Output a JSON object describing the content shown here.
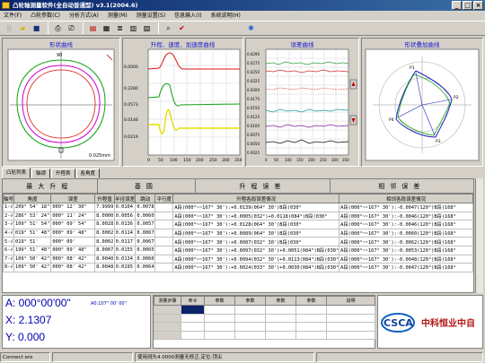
{
  "window": {
    "title": "凸轮轴测量软件(全自动普通型)  v3.1(2004.6)"
  },
  "menu": [
    "文件(F)",
    "凸轮参数(C)",
    "分析方式(A)",
    "测量(M)",
    "测量设置(S)",
    "信息输入(I)",
    "系统说明(H)"
  ],
  "toolbar_icons": [
    "new-icon",
    "open-icon",
    "save-icon",
    "print-icon",
    "print-preview-icon",
    "chart-icon",
    "table-icon",
    "list-icon",
    "grid-icon",
    "report-icon",
    "magnify-icon",
    "check-icon",
    "measure-icon"
  ],
  "panels": {
    "profile": {
      "title": "形状曲线",
      "top_label": "90",
      "scale_label": "0.025mm"
    },
    "kinematics": {
      "title": "升程、速度、加速度曲线",
      "y_ticks": [
        "6.0000",
        "0.2280",
        "0.0573",
        "0.0146",
        "0.0219"
      ],
      "x_ticks": [
        "0",
        "50",
        "100",
        "150",
        "200",
        "250",
        "300",
        "350"
      ]
    },
    "error": {
      "title": "误差曲线",
      "y_ticks": [
        "0.0290",
        "0.0275",
        "0.0250",
        "0.0225",
        "0.0200",
        "0.0175",
        "0.0150",
        "0.0125",
        "0.0100",
        "0.0075",
        "0.0050",
        "0.0025"
      ],
      "x_ticks": [
        "0",
        "50",
        "100",
        "150",
        "200",
        "250",
        "300",
        "350"
      ]
    },
    "polar": {
      "title": "形状叠加曲线",
      "labels": [
        "P1",
        "P2",
        "P3",
        "P4"
      ]
    }
  },
  "tabs": [
    "凸轮列表",
    "轴颈",
    "升程表",
    "各角度"
  ],
  "table": {
    "group_headers": [
      "最大升程",
      "基圆",
      "升程误差",
      "相邻误差"
    ],
    "columns": [
      "轴号",
      "角度",
      "误差",
      "升程值",
      "半径误差",
      "跳动",
      "平行度",
      "升程各段误差情况",
      "相邻各段误差情况"
    ],
    "rows": [
      [
        "1-√",
        "209° 54' 18\"",
        "000° 12' 30\"",
        "7.9999",
        "0.0104",
        "0.0078",
        "",
        "A段(000°~~167° 30'):+0.0139(064° 30')B段(030°",
        "A段(000°~~167° 30'):-0.0047(120°)B段(168°"
      ],
      [
        "2-√",
        "286° 53' 24\"",
        "000° 11' 24\"",
        "8.0000",
        "0.0056",
        "0.0060",
        "",
        "A段(000°~~167° 30'):+0.0005(032°)+0.0118(084°)B段(030°",
        "A段(000°~~167° 30'):-0.0046(120°)B段(168°"
      ],
      [
        "3-√",
        "109° 51' 54\"",
        "000° 09' 54\"",
        "8.0028",
        "0.0136",
        "0.0057",
        "",
        "A段(000°~~167° 30'):+0.0128(064° 30')B段(030°",
        "A段(000°~~167° 30'):-0.0046(120°)B段(168°"
      ],
      [
        "4-√",
        "019° 51' 48\"",
        "000° 09' 48\"",
        "8.0002",
        "0.0114",
        "0.0067",
        "",
        "A段(000°~~167° 30'):+0.0089(064° 30')B段(030°",
        "A段(000°~~167° 30'):-0.0060(120°)B段(168°"
      ],
      [
        "5-√",
        "019° 51'",
        "000° 09'",
        "8.0002",
        "0.0117",
        "0.0067",
        "",
        "A段(000°~~167° 30'):+0.0087(032° 30')B段(030°",
        "A段(000°~~167° 30'):-0.0062(120°)B段(168°"
      ],
      [
        "6-√",
        "199° 51' 48\"",
        "000° 09' 48\"",
        "8.0007",
        "0.0155",
        "0.0065",
        "",
        "A段(000°~~167° 30'):+0.0097(032° 30')+0.0051(084°)B段(030°",
        "A段(000°~~167° 30'):-0.0053(120°)B段(168°"
      ],
      [
        "7-√",
        "109° 50' 42\"",
        "000° 08' 42\"",
        "8.0040",
        "0.0134",
        "0.0060",
        "",
        "A段(000°~~167° 30'):+0.0094(032° 30')+0.0113(084°)B段(030°",
        "A段(000°~~167° 30'):-0.0048(120°)B段(168°"
      ],
      [
        "8-√",
        "109° 50' 42\"",
        "000° 08' 42\"",
        "8.0048",
        "0.0195",
        "0.0064",
        "",
        "A段(000°~~167° 30'):+0.0024(033° 30')+0.0030(084°)B段(030°",
        "A段(000°~~167° 30'):-0.0047(120°)B段(168°"
      ]
    ]
  },
  "readout": {
    "angle": "A: 000°00'00\"",
    "angle_sub": "A0:107° 00' 00\"",
    "x": "X: 2.1307",
    "y": "Y: 0.000"
  },
  "log": {
    "columns": [
      "测量步骤",
      "命令",
      "参数",
      "参数",
      "参数",
      "参数",
      "说明"
    ]
  },
  "logo": {
    "text": "CSCA",
    "company": "中科恒业中自"
  },
  "status": {
    "left": "Connect ero",
    "right": "使用测头4.0000测量无修正,定位:顶尖"
  },
  "colors": {
    "title_bar": "#0a246a",
    "accent_blue": "#1818c8"
  }
}
